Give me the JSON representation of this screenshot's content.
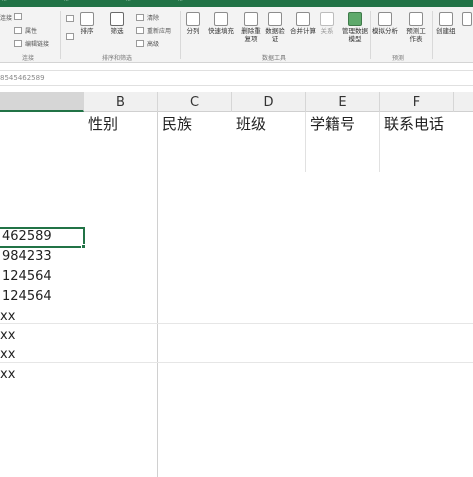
{
  "titlebar": {
    "items": [
      "...",
      "...",
      "...",
      "..."
    ]
  },
  "ribbon": {
    "left_group": {
      "items": [
        "连接",
        "属性",
        "编辑链接"
      ],
      "label": "连接"
    },
    "sort_group": {
      "sort_label": "排序",
      "filter_label": "筛选",
      "clear_label": "清除",
      "reapply_label": "重新应用",
      "advanced_label": "高级",
      "label": "排序和筛选"
    },
    "tools_group": {
      "buttons": [
        "分列",
        "快速填充",
        "删除重复项",
        "数据验证",
        "合并计算",
        "关系",
        "管理数据模型"
      ],
      "label": "数据工具"
    },
    "forecast_group": {
      "buttons": [
        "模拟分析",
        "预测工作表"
      ],
      "label": "预测"
    },
    "outline_group": {
      "buttons": [
        "创建组"
      ]
    }
  },
  "formula_bar": {
    "value": "8545462589"
  },
  "columns": [
    "B",
    "C",
    "D",
    "E",
    "F"
  ],
  "headers": [
    "性别",
    "民族",
    "班级",
    "学籍号",
    "联系电话"
  ],
  "col_a_values": [
    "462589",
    "984233",
    "124564",
    "124564",
    "xx",
    "xx",
    "xx",
    "xx"
  ],
  "colors": {
    "accent": "#217346"
  }
}
